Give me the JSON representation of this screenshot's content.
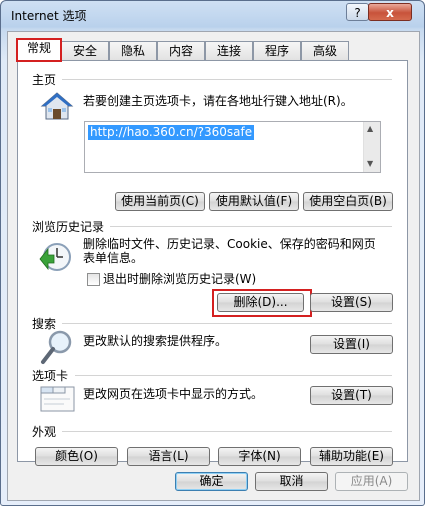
{
  "window": {
    "title": "Internet 选项",
    "help_label": "?",
    "close_label": "x"
  },
  "tabs": [
    {
      "label": "常规",
      "active": true
    },
    {
      "label": "安全"
    },
    {
      "label": "隐私"
    },
    {
      "label": "内容"
    },
    {
      "label": "连接"
    },
    {
      "label": "程序"
    },
    {
      "label": "高级"
    }
  ],
  "homepage": {
    "section": "主页",
    "description": "若要创建主页选项卡，请在各地址行键入地址(R)。",
    "url": "http://hao.360.cn/?360safe",
    "btn_current": "使用当前页(C)",
    "btn_default": "使用默认值(F)",
    "btn_blank": "使用空白页(B)"
  },
  "history": {
    "section": "浏览历史记录",
    "description_line1": "删除临时文件、历史记录、Cookie、保存的密码和网页",
    "description_line2": "表单信息。",
    "checkbox_label": "退出时删除浏览历史记录(W)",
    "btn_delete": "删除(D)...",
    "btn_settings": "设置(S)"
  },
  "search": {
    "section": "搜索",
    "description": "更改默认的搜索提供程序。",
    "btn_settings": "设置(I)"
  },
  "tabsgroup": {
    "section": "选项卡",
    "description": "更改网页在选项卡中显示的方式。",
    "btn_settings": "设置(T)"
  },
  "appearance": {
    "section": "外观",
    "btn_colors": "颜色(O)",
    "btn_languages": "语言(L)",
    "btn_fonts": "字体(N)",
    "btn_accessibility": "辅助功能(E)"
  },
  "footer": {
    "btn_ok": "确定",
    "btn_cancel": "取消",
    "btn_apply": "应用(A)"
  }
}
